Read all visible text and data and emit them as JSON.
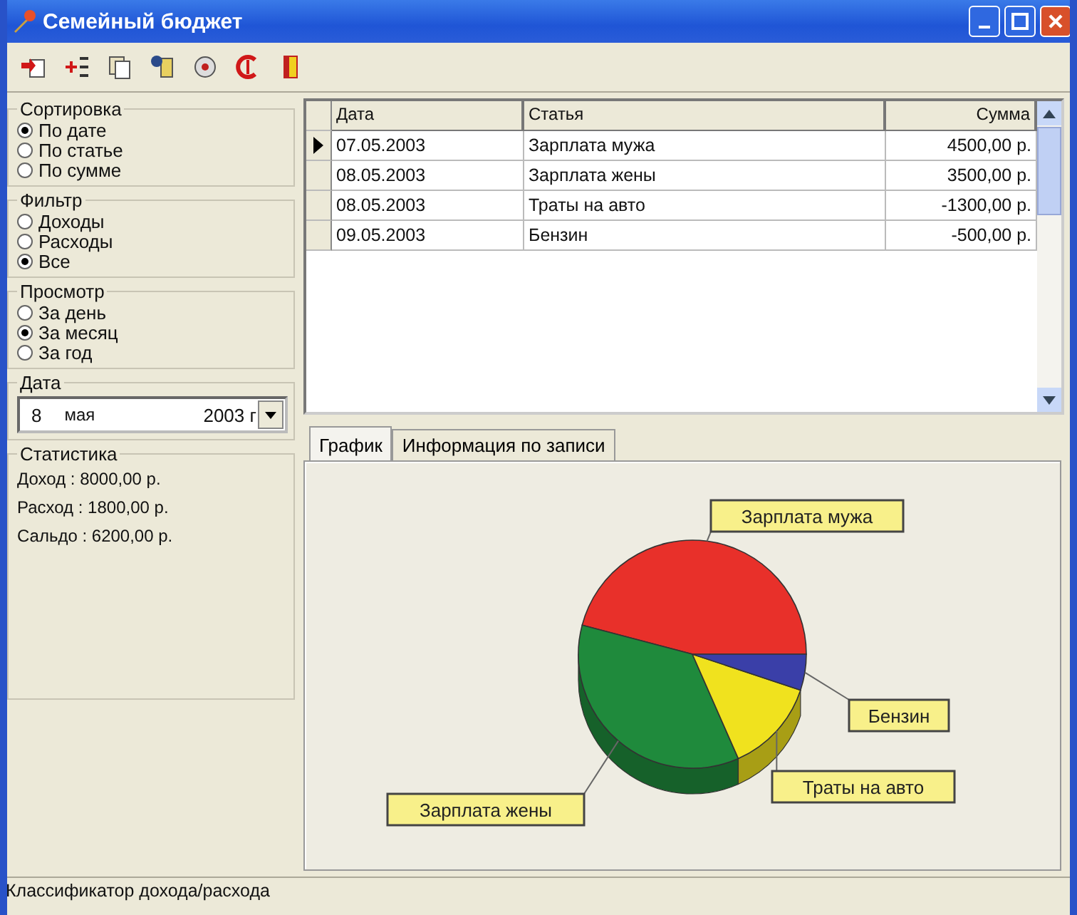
{
  "window": {
    "title": "Семейный бюджет"
  },
  "toolbar": [
    {
      "kind": "doc-arrow"
    },
    {
      "kind": "plus"
    },
    {
      "kind": "docs"
    },
    {
      "kind": "brush"
    },
    {
      "kind": "disc"
    },
    {
      "kind": "ring"
    },
    {
      "kind": "door"
    }
  ],
  "groups": [
    {
      "title": "Сортировка",
      "options": [
        {
          "label": "По дате",
          "selected": true
        },
        {
          "label": "По статье",
          "selected": false
        },
        {
          "label": "По сумме",
          "selected": false
        }
      ]
    },
    {
      "title": "Фильтр",
      "options": [
        {
          "label": "Доходы",
          "selected": false
        },
        {
          "label": "Расходы",
          "selected": false
        },
        {
          "label": "Все",
          "selected": true
        }
      ]
    },
    {
      "title": "Просмотр",
      "options": [
        {
          "label": "За день",
          "selected": false
        },
        {
          "label": "За месяц",
          "selected": true
        },
        {
          "label": "За год",
          "selected": false
        }
      ]
    }
  ],
  "date": {
    "title": "Дата",
    "day": "8",
    "month": "мая",
    "year": "2003 г"
  },
  "statistics": {
    "title": "Статистика",
    "lines": [
      "Доход : 8000,00 р.",
      "Расход : 1800,00 р.",
      "Сальдо : 6200,00 р."
    ]
  },
  "table": {
    "columns": [
      "Дата",
      "Статья",
      "Сумма"
    ],
    "rows": [
      {
        "cells": [
          "07.05.2003",
          "Зарплата мужа",
          "4500,00 р."
        ],
        "current": true
      },
      {
        "cells": [
          "08.05.2003",
          "Зарплата жены",
          "3500,00 р."
        ],
        "current": false
      },
      {
        "cells": [
          "08.05.2003",
          "Траты на авто",
          "-1300,00 р."
        ],
        "current": false
      },
      {
        "cells": [
          "09.05.2003",
          "Бензин",
          "-500,00 р."
        ],
        "current": false
      }
    ]
  },
  "tabs": [
    {
      "label": "График",
      "selected": true
    },
    {
      "label": "Информация по записи",
      "selected": false
    }
  ],
  "chart_data": {
    "type": "pie",
    "categories": [
      "Зарплата мужа",
      "Зарплата жены",
      "Траты на авто",
      "Бензин"
    ],
    "values": [
      45.9,
      35.7,
      13.3,
      5.1
    ],
    "colors": [
      "#e8302a",
      "#1f8a3c",
      "#f0e21e",
      "#3a3fa8"
    ]
  },
  "status_bar": "Классификатор дохода/расхода"
}
